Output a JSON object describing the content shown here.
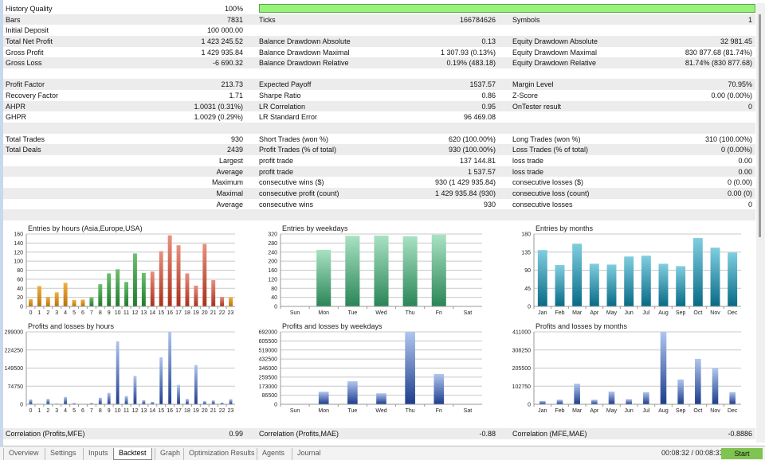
{
  "stats": {
    "rows": [
      [
        "History Quality",
        "100%",
        "",
        "",
        "",
        ""
      ],
      [
        "Bars",
        "7831",
        "Ticks",
        "166784626",
        "Symbols",
        "1"
      ],
      [
        "Initial Deposit",
        "100 000.00",
        "",
        "",
        "",
        ""
      ],
      [
        "Total Net Profit",
        "1 423 245.52",
        "Balance Drawdown Absolute",
        "0.13",
        "Equity Drawdown Absolute",
        "32 981.45"
      ],
      [
        "Gross Profit",
        "1 429 935.84",
        "Balance Drawdown Maximal",
        "1 307.93 (0.13%)",
        "Equity Drawdown Maximal",
        "830 877.68 (81.74%)"
      ],
      [
        "Gross Loss",
        "-6 690.32",
        "Balance Drawdown Relative",
        "0.19% (483.18)",
        "Equity Drawdown Relative",
        "81.74% (830 877.68)"
      ],
      [
        "",
        "",
        "",
        "",
        "",
        ""
      ],
      [
        "Profit Factor",
        "213.73",
        "Expected Payoff",
        "1537.57",
        "Margin Level",
        "70.95%"
      ],
      [
        "Recovery Factor",
        "1.71",
        "Sharpe Ratio",
        "0.86",
        "Z-Score",
        "0.00 (0.00%)"
      ],
      [
        "AHPR",
        "1.0031 (0.31%)",
        "LR Correlation",
        "0.95",
        "OnTester result",
        "0"
      ],
      [
        "GHPR",
        "1.0029 (0.29%)",
        "LR Standard Error",
        "96 469.08",
        "",
        ""
      ],
      [
        "",
        "",
        "",
        "",
        "",
        ""
      ],
      [
        "Total Trades",
        "930",
        "Short Trades (won %)",
        "620 (100.00%)",
        "Long Trades (won %)",
        "310 (100.00%)"
      ],
      [
        "Total Deals",
        "2439",
        "Profit Trades (% of total)",
        "930 (100.00%)",
        "Loss Trades (% of total)",
        "0 (0.00%)"
      ],
      [
        "",
        "Largest",
        "profit trade",
        "137 144.81",
        "loss trade",
        "0.00"
      ],
      [
        "",
        "Average",
        "profit trade",
        "1 537.57",
        "loss trade",
        "0.00"
      ],
      [
        "",
        "Maximum",
        "consecutive wins ($)",
        "930 (1 429 935.84)",
        "consecutive losses ($)",
        "0 (0.00)"
      ],
      [
        "",
        "Maximal",
        "consecutive profit (count)",
        "1 429 935.84 (930)",
        "consecutive loss (count)",
        "0.00 (0)"
      ],
      [
        "",
        "Average",
        "consecutive wins",
        "930",
        "consecutive losses",
        "0"
      ],
      [
        "",
        "",
        "",
        "",
        "",
        ""
      ]
    ],
    "history_quality_pct": 100
  },
  "correlation": [
    "Correlation (Profits,MFE)",
    "0.99",
    "Correlation (Profits,MAE)",
    "-0.88",
    "Correlation (MFE,MAE)",
    "-0.8886"
  ],
  "tabs": [
    "Overview",
    "Settings",
    "Inputs",
    "Backtest",
    "Graph",
    "Optimization Results",
    "Agents",
    "Journal"
  ],
  "active_tab": "Backtest",
  "timer": "00:08:32 / 00:08:33",
  "start_label": "Start",
  "colors": {
    "asia": "#d08c12",
    "europe": "#2f8f3c",
    "usa": "#c4452c",
    "weekday": "#2e8a5a",
    "month": "#0e7290",
    "pl": "#2a4a98",
    "progress": "#99f27a"
  },
  "chart_data": [
    {
      "type": "bar",
      "title": "Entries by hours (Asia,Europe,USA)",
      "categories": [
        "0",
        "1",
        "2",
        "3",
        "4",
        "5",
        "6",
        "7",
        "8",
        "9",
        "10",
        "11",
        "12",
        "13",
        "14",
        "15",
        "16",
        "17",
        "18",
        "19",
        "20",
        "21",
        "22",
        "23"
      ],
      "values": [
        16,
        45,
        21,
        31,
        52,
        14,
        15,
        20,
        49,
        73,
        82,
        54,
        117,
        74,
        77,
        122,
        157,
        135,
        73,
        46,
        138,
        58,
        21,
        20
      ],
      "sessions": [
        "asia",
        "asia",
        "asia",
        "asia",
        "asia",
        "asia",
        "asia",
        "europe",
        "europe",
        "europe",
        "europe",
        "europe",
        "europe",
        "europe",
        "usa",
        "usa",
        "usa",
        "usa",
        "usa",
        "usa",
        "usa",
        "usa",
        "usa",
        "asia"
      ],
      "yticks": [
        0,
        20,
        40,
        60,
        80,
        100,
        120,
        140,
        160
      ],
      "ylim": [
        0,
        160
      ],
      "grid": true
    },
    {
      "type": "bar",
      "title": "Entries by weekdays",
      "categories": [
        "Sun",
        "Mon",
        "Tue",
        "Wed",
        "Thu",
        "Fri",
        "Sat"
      ],
      "values": [
        0,
        250,
        312,
        313,
        310,
        317,
        0
      ],
      "yticks": [
        0,
        40,
        80,
        120,
        160,
        200,
        240,
        280,
        320
      ],
      "ylim": [
        0,
        320
      ],
      "grid": true
    },
    {
      "type": "bar",
      "title": "Entries by months",
      "categories": [
        "Jan",
        "Feb",
        "Mar",
        "Apr",
        "May",
        "Jun",
        "Jul",
        "Aug",
        "Sep",
        "Oct",
        "Nov",
        "Dec"
      ],
      "values": [
        140,
        103,
        156,
        106,
        104,
        124,
        126,
        106,
        100,
        170,
        146,
        134
      ],
      "yticks": [
        0,
        45,
        90,
        135,
        180
      ],
      "ylim": [
        0,
        180
      ],
      "grid": true
    },
    {
      "type": "bar",
      "title": "Profits and losses by hours",
      "categories": [
        "0",
        "1",
        "2",
        "3",
        "4",
        "5",
        "6",
        "7",
        "8",
        "9",
        "10",
        "11",
        "12",
        "13",
        "14",
        "15",
        "16",
        "17",
        "18",
        "19",
        "20",
        "21",
        "22",
        "23"
      ],
      "values": [
        20000,
        0,
        22000,
        3000,
        30000,
        5000,
        1000,
        5000,
        27000,
        47000,
        260000,
        34000,
        117000,
        17000,
        10000,
        194000,
        299000,
        80000,
        22000,
        162000,
        13000,
        16000,
        7000,
        21000
      ],
      "yticks": [
        0,
        74750,
        149500,
        224250,
        299000
      ],
      "ylim": [
        0,
        299000
      ],
      "grid": true
    },
    {
      "type": "bar",
      "title": "Profits and losses by weekdays",
      "categories": [
        "Sun",
        "Mon",
        "Tue",
        "Wed",
        "Thu",
        "Fri",
        "Sat"
      ],
      "values": [
        0,
        120000,
        220000,
        105000,
        692000,
        290000,
        0
      ],
      "yticks": [
        0,
        86500,
        173000,
        259500,
        346000,
        432500,
        519000,
        605500,
        692000
      ],
      "ylim": [
        0,
        692000
      ],
      "grid": true
    },
    {
      "type": "bar",
      "title": "Profits and losses by months",
      "categories": [
        "Jan",
        "Feb",
        "Mar",
        "Apr",
        "May",
        "Jun",
        "Jul",
        "Aug",
        "Sep",
        "Oct",
        "Nov",
        "Dec"
      ],
      "values": [
        19000,
        26000,
        117000,
        26000,
        72000,
        29000,
        69000,
        411000,
        141000,
        258000,
        204000,
        69000
      ],
      "yticks": [
        0,
        102750,
        205500,
        308250,
        411000
      ],
      "ylim": [
        0,
        411000
      ],
      "grid": true
    }
  ]
}
